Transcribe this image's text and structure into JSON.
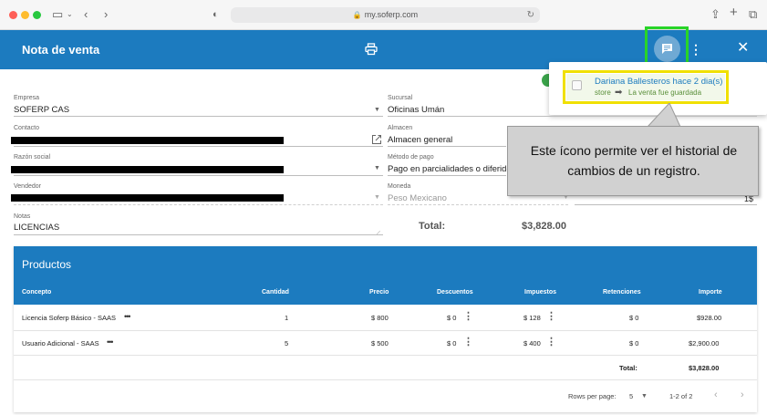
{
  "browser": {
    "url": "my.soferp.com"
  },
  "header": {
    "title": "Nota de venta"
  },
  "history_popup": {
    "entry": {
      "who": "Dariana Ballesteros hace 2 dia(s)",
      "field": "store",
      "value": "La venta fue guardada"
    }
  },
  "form": {
    "empresa": {
      "label": "Empresa",
      "value": "SOFERP CAS"
    },
    "sucursal": {
      "label": "Sucursal",
      "value": "Oficinas Umán"
    },
    "contacto": {
      "label": "Contacto",
      "value": ""
    },
    "almacen": {
      "label": "Almacen",
      "value": "Almacen general"
    },
    "razon_social": {
      "label": "Razón social",
      "value": ""
    },
    "metodo_pago": {
      "label": "Método de pago",
      "value": "Pago en parcialidades o diferido"
    },
    "vendedor": {
      "label": "Vendedor",
      "value": ""
    },
    "moneda": {
      "label": "Moneda",
      "value": "Peso Mexicano"
    },
    "tipo_cambio": {
      "value": "1$"
    },
    "notas": {
      "label": "Notas",
      "value": "LICENCIAS"
    },
    "total_label": "Total:",
    "total_value": "$3,828.00"
  },
  "callout": {
    "line1": "Este ícono permite ver el historial de",
    "line2": "cambios de un registro."
  },
  "products": {
    "title": "Productos",
    "columns": [
      "Concepto",
      "Cantidad",
      "Precio",
      "Descuentos",
      "Impuestos",
      "Retenciones",
      "Importe"
    ],
    "rows": [
      {
        "concepto": "Licencia Soferp Básico - SAAS",
        "cantidad": "1",
        "precio": "$ 800",
        "descuentos": "$ 0",
        "impuestos": "$ 128",
        "retenciones": "$ 0",
        "importe": "$928.00"
      },
      {
        "concepto": "Usuario Adicional - SAAS",
        "cantidad": "5",
        "precio": "$ 500",
        "descuentos": "$ 0",
        "impuestos": "$ 400",
        "retenciones": "$ 0",
        "importe": "$2,900.00"
      }
    ],
    "total_label": "Total:",
    "total_value": "$3,828.00",
    "more_glyph": "•••",
    "pagination": {
      "rows_per_page_label": "Rows per page:",
      "rows_per_page_value": "5",
      "range": "1-2 of 2"
    }
  },
  "colors": {
    "primary": "#1c7bbf",
    "highlight_green": "#28d428",
    "highlight_yellow": "#f0e000"
  }
}
